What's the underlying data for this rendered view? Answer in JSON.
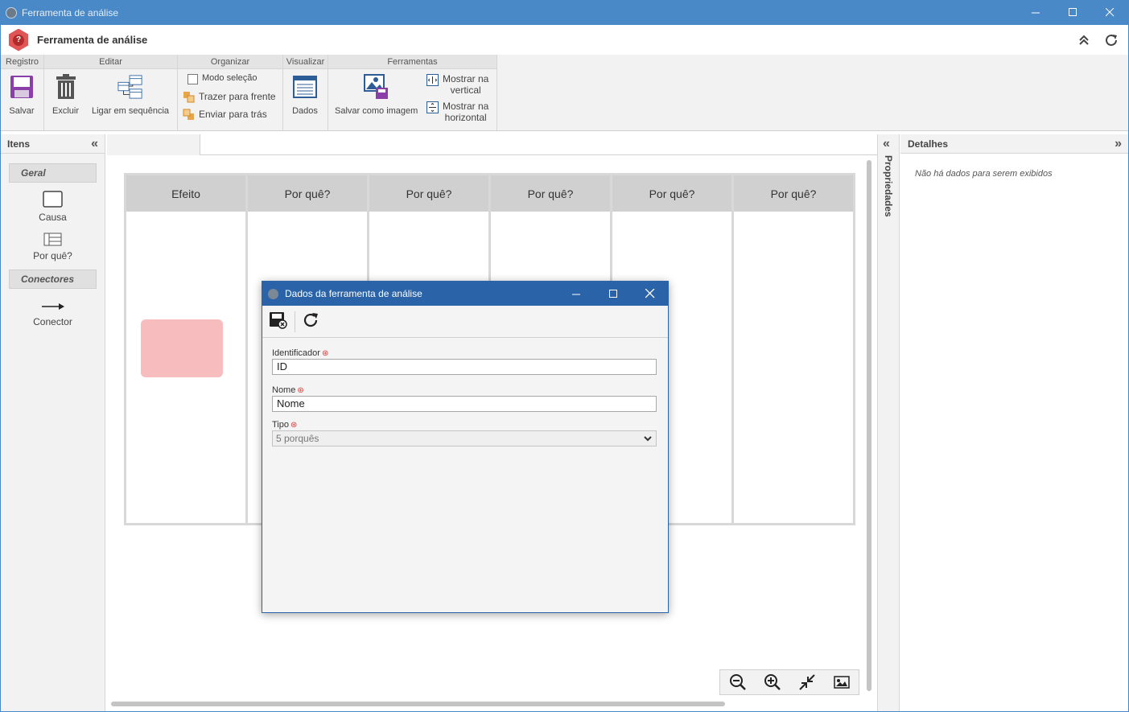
{
  "window": {
    "title": "Ferramenta de análise"
  },
  "header": {
    "title": "Ferramenta de análise"
  },
  "ribbon": {
    "groups": {
      "registro": "Registro",
      "editar": "Editar",
      "organizar": "Organizar",
      "visualizar": "Visualizar",
      "ferramentas": "Ferramentas"
    },
    "salvar": "Salvar",
    "excluir": "Excluir",
    "ligar": "Ligar em sequência",
    "modo_selecao": "Modo seleção",
    "trazer": "Trazer para frente",
    "enviar": "Enviar para trás",
    "dados": "Dados",
    "salvar_imagem": "Salvar como imagem",
    "mostrar_vertical_1": "Mostrar na",
    "mostrar_vertical_2": "vertical",
    "mostrar_horizontal_1": "Mostrar na",
    "mostrar_horizontal_2": "horizontal"
  },
  "left_panel": {
    "title": "Itens",
    "geral": "Geral",
    "causa": "Causa",
    "porque": "Por quê?",
    "conectores": "Conectores",
    "conector": "Conector"
  },
  "diagram": {
    "columns": [
      "Efeito",
      "Por quê?",
      "Por quê?",
      "Por quê?",
      "Por quê?",
      "Por quê?"
    ]
  },
  "properties": {
    "label": "Propriedades"
  },
  "right_panel": {
    "title": "Detalhes",
    "empty": "Não há dados para serem exibidos"
  },
  "dialog": {
    "title": "Dados da ferramenta de análise",
    "identificador_label": "Identificador",
    "identificador_value": "ID",
    "nome_label": "Nome",
    "nome_value": "Nome",
    "tipo_label": "Tipo",
    "tipo_value": "5 porquês"
  },
  "colors": {
    "title_bar": "#4a89c8",
    "dialog_title": "#2a63a8",
    "cause_fill": "#f7bcbe",
    "required": "#d33333"
  }
}
